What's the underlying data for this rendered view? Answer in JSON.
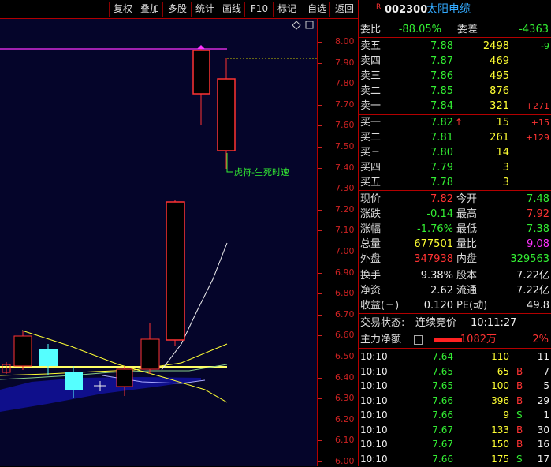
{
  "toolbar": {
    "buttons": [
      "复权",
      "叠加",
      "多股",
      "统计",
      "画线",
      "F10",
      "标记",
      "-自选",
      "返回"
    ]
  },
  "chart": {
    "y_ticks": [
      "8.00",
      "7.90",
      "7.80",
      "7.70",
      "7.60",
      "7.50",
      "7.40",
      "7.30",
      "7.20",
      "7.10",
      "7.00",
      "6.90",
      "6.80",
      "6.70",
      "6.60",
      "6.50",
      "6.40",
      "6.30",
      "6.20",
      "6.10",
      "6.00"
    ],
    "annotation": "虎符-生死时速"
  },
  "quote": {
    "flag": "R",
    "code": "002300",
    "name": "太阳电缆",
    "weibi_label": "委比",
    "weibi_value": "-88.05%",
    "weicha_label": "委差",
    "weicha_value": "-4363",
    "asks": [
      {
        "label": "卖五",
        "price": "7.88",
        "vol": "2498",
        "chg": "-9"
      },
      {
        "label": "卖四",
        "price": "7.87",
        "vol": "469",
        "chg": ""
      },
      {
        "label": "卖三",
        "price": "7.86",
        "vol": "495",
        "chg": ""
      },
      {
        "label": "卖二",
        "price": "7.85",
        "vol": "876",
        "chg": ""
      },
      {
        "label": "卖一",
        "price": "7.84",
        "vol": "321",
        "chg": "+271"
      }
    ],
    "bids": [
      {
        "label": "买一",
        "price": "7.82",
        "arrow": "↑",
        "vol": "15",
        "chg": "+15"
      },
      {
        "label": "买二",
        "price": "7.81",
        "arrow": "",
        "vol": "261",
        "chg": "+129"
      },
      {
        "label": "买三",
        "price": "7.80",
        "arrow": "",
        "vol": "14",
        "chg": ""
      },
      {
        "label": "买四",
        "price": "7.79",
        "arrow": "",
        "vol": "3",
        "chg": ""
      },
      {
        "label": "买五",
        "price": "7.78",
        "arrow": "",
        "vol": "3",
        "chg": ""
      }
    ],
    "stats": [
      {
        "l1": "现价",
        "v1": "7.82",
        "c1": "red",
        "l2": "今开",
        "v2": "7.48",
        "c2": "green"
      },
      {
        "l1": "涨跌",
        "v1": "-0.14",
        "c1": "green",
        "l2": "最高",
        "v2": "7.92",
        "c2": "red"
      },
      {
        "l1": "涨幅",
        "v1": "-1.76%",
        "c1": "green",
        "l2": "最低",
        "v2": "7.38",
        "c2": "green"
      },
      {
        "l1": "总量",
        "v1": "677501",
        "c1": "yellow",
        "l2": "量比",
        "v2": "9.08",
        "c2": "mag"
      },
      {
        "l1": "外盘",
        "v1": "347938",
        "c1": "red",
        "l2": "内盘",
        "v2": "329563",
        "c2": "green"
      }
    ],
    "fundamentals": [
      {
        "l1": "换手",
        "v1": "9.38%",
        "l2": "股本",
        "v2": "7.22亿"
      },
      {
        "l1": "净资",
        "v1": "2.62",
        "l2": "流通",
        "v2": "7.22亿"
      },
      {
        "l1": "收益(三)",
        "v1": "0.120",
        "l2": "PE(动)",
        "v2": "49.8"
      }
    ],
    "trade_status_label": "交易状态:",
    "trade_status_value": "连续竞价",
    "trade_time": "10:11:27",
    "main_flow_label": "主力净额",
    "main_flow_value": "1082万",
    "main_flow_pct": "2%",
    "ticks": [
      {
        "time": "10:10",
        "price": "7.64",
        "vol": "110",
        "bs": "",
        "n": "11"
      },
      {
        "time": "10:10",
        "price": "7.65",
        "vol": "65",
        "bs": "B",
        "n": "7"
      },
      {
        "time": "10:10",
        "price": "7.65",
        "vol": "100",
        "bs": "B",
        "n": "5"
      },
      {
        "time": "10:10",
        "price": "7.66",
        "vol": "396",
        "bs": "B",
        "n": "29"
      },
      {
        "time": "10:10",
        "price": "7.66",
        "vol": "9",
        "bs": "S",
        "n": "1"
      },
      {
        "time": "10:10",
        "price": "7.67",
        "vol": "133",
        "bs": "B",
        "n": "30"
      },
      {
        "time": "10:10",
        "price": "7.67",
        "vol": "150",
        "bs": "B",
        "n": "16"
      },
      {
        "time": "10:10",
        "price": "7.66",
        "vol": "175",
        "bs": "S",
        "n": "17"
      }
    ]
  }
}
